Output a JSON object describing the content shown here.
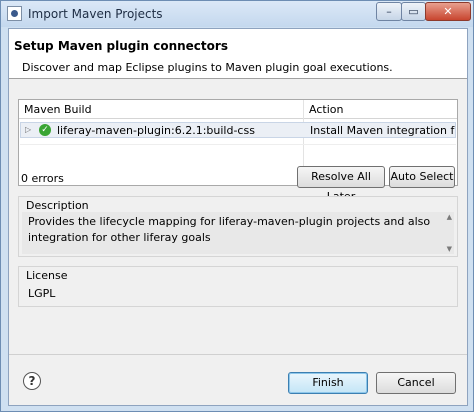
{
  "window": {
    "title": "Import Maven Projects",
    "minimize_glyph": "–",
    "maximize_glyph": "▭",
    "close_glyph": "✕"
  },
  "header": {
    "title": "Setup Maven plugin connectors",
    "description": "Discover and map Eclipse plugins to Maven plugin goal executions."
  },
  "table": {
    "columns": [
      "Maven Build",
      "Action"
    ],
    "rows": [
      {
        "expander": "▷",
        "status_icon": "check-icon",
        "status_glyph": "✓",
        "build": "liferay-maven-plugin:6.2.1:build-css",
        "action": "Install Maven integration for"
      }
    ]
  },
  "errors_label": "0 errors",
  "buttons": {
    "resolve_all_later": "Resolve All Later",
    "auto_select": "Auto Select",
    "finish": "Finish",
    "cancel": "Cancel",
    "help": "?"
  },
  "description": {
    "label": "Description",
    "text": "Provides the lifecycle mapping for liferay-maven-plugin projects and also integration for other liferay goals",
    "scroll_up": "▲",
    "scroll_down": "▼"
  },
  "license": {
    "label": "License",
    "text": "LGPL"
  },
  "colors": {
    "window_frame": "#cfe0f1",
    "close_button": "#c8452f",
    "success_check": "#3aa533",
    "default_button": "#c4e5f6"
  }
}
